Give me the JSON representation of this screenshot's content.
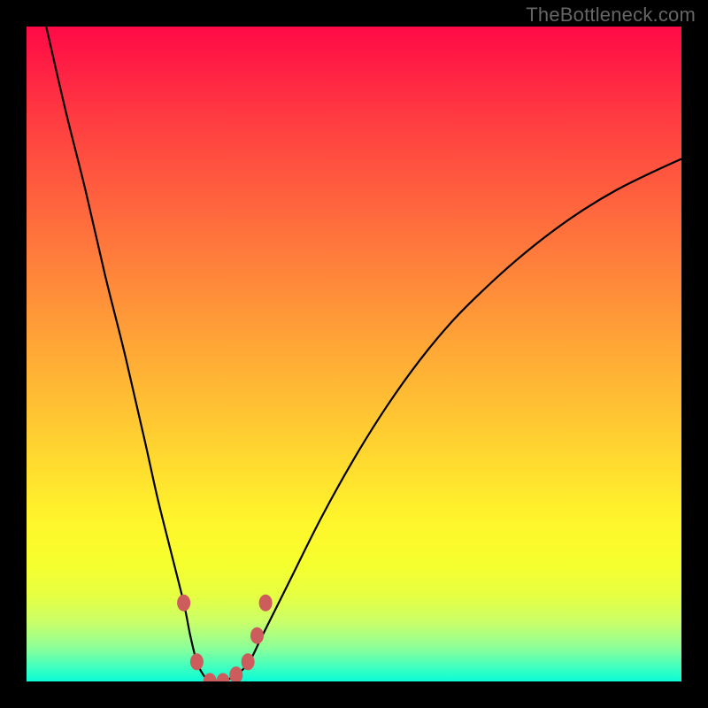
{
  "watermark": "TheBottleneck.com",
  "chart_data": {
    "type": "line",
    "title": "",
    "xlabel": "",
    "ylabel": "",
    "xlim": [
      0,
      100
    ],
    "ylim": [
      0,
      100
    ],
    "grid": false,
    "series": [
      {
        "name": "curve",
        "x": [
          3,
          6,
          9,
          12,
          15,
          18,
          20,
          22,
          24,
          25,
          26,
          27,
          28,
          29,
          30,
          32,
          34,
          36,
          40,
          45,
          50,
          55,
          60,
          65,
          70,
          75,
          80,
          85,
          90,
          95,
          100
        ],
        "values": [
          100,
          87,
          75,
          62,
          50,
          37,
          28,
          20,
          12,
          7,
          3,
          1,
          0,
          0,
          0,
          1,
          3,
          7,
          15,
          25,
          34,
          42,
          49,
          55,
          60,
          64.5,
          68.5,
          72,
          75,
          77.5,
          79.8
        ]
      }
    ],
    "markers": [
      {
        "x": 24.0,
        "y": 12
      },
      {
        "x": 26.0,
        "y": 3
      },
      {
        "x": 28.0,
        "y": 0
      },
      {
        "x": 30.0,
        "y": 0
      },
      {
        "x": 32.0,
        "y": 1
      },
      {
        "x": 33.8,
        "y": 3
      },
      {
        "x": 35.2,
        "y": 7
      },
      {
        "x": 36.5,
        "y": 12
      }
    ],
    "colors": {
      "line": "#000000",
      "marker_fill": "#cd5c5c",
      "marker_stroke": "#cd5c5c"
    }
  }
}
